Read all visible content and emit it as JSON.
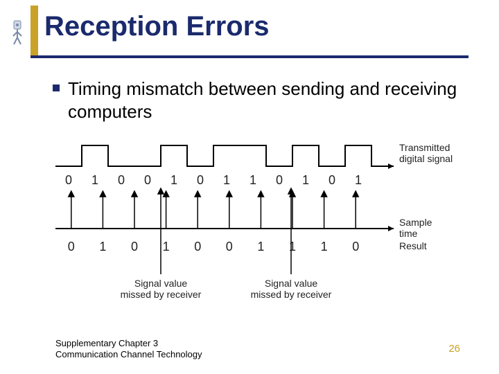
{
  "title": "Reception Errors",
  "bullet": "Timing mismatch between sending and receiving computers",
  "footer": {
    "line1": "Supplementary Chapter 3",
    "line2": "Communication Channel Technology",
    "page": "26"
  },
  "diagram": {
    "top_label": "Transmitted\ndigital signal",
    "mid_label": "Sample\ntime",
    "result_label": "Result",
    "miss_left_l1": "Signal value",
    "miss_left_l2": "missed by receiver",
    "miss_right_l1": "Signal value",
    "miss_right_l2": "missed by receiver",
    "bits_top": [
      "0",
      "1",
      "0",
      "0",
      "1",
      "0",
      "1",
      "1",
      "0",
      "1",
      "0",
      "1"
    ],
    "bits_bottom": [
      "0",
      "1",
      "0",
      "1",
      "0",
      "0",
      "1",
      "1",
      "1",
      "0"
    ]
  },
  "chart_data": {
    "type": "table",
    "title": "Reception Errors — timing mismatch illustration",
    "transmitted_signal_bits": [
      0,
      1,
      0,
      0,
      1,
      0,
      1,
      1,
      0,
      1,
      0,
      1
    ],
    "sampled_result_bits": [
      0,
      1,
      0,
      1,
      0,
      0,
      1,
      1,
      1,
      0
    ],
    "events": [
      {
        "label": "Signal value missed by receiver",
        "between_transmitted_indices": [
          3,
          4
        ]
      },
      {
        "label": "Signal value missed by receiver",
        "between_transmitted_indices": [
          8,
          9
        ]
      }
    ],
    "series": [
      {
        "name": "Transmitted digital signal",
        "values": [
          0,
          1,
          0,
          0,
          1,
          0,
          1,
          1,
          0,
          1,
          0,
          1
        ]
      },
      {
        "name": "Result",
        "values": [
          0,
          1,
          0,
          1,
          0,
          0,
          1,
          1,
          1,
          0
        ]
      }
    ]
  }
}
